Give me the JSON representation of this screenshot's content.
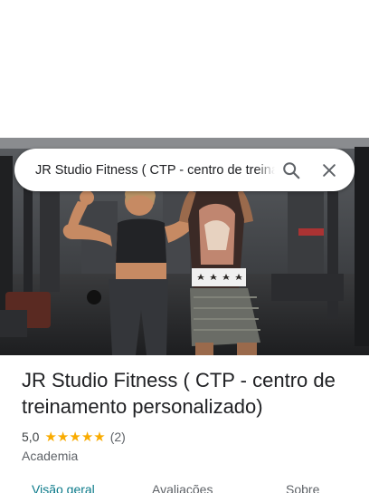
{
  "search": {
    "query": "JR Studio Fitness ( CTP - centro de treinamento personalizado)",
    "search_icon": "search-icon",
    "close_icon": "close-icon"
  },
  "place": {
    "title": "JR Studio Fitness ( CTP - centro de treinamento personalizado)",
    "rating": "5,0",
    "rating_fraction": 1.0,
    "stars": 5,
    "review_count": "(2)",
    "category": "Academia"
  },
  "tabs": [
    {
      "label": "Visão geral",
      "active": true
    },
    {
      "label": "Avaliações",
      "active": false
    },
    {
      "label": "Sobre",
      "active": false
    }
  ],
  "colors": {
    "star": "#f9ab00",
    "active_tab": "#0b7a8a",
    "text_primary": "#202124",
    "text_secondary": "#5f6368"
  }
}
